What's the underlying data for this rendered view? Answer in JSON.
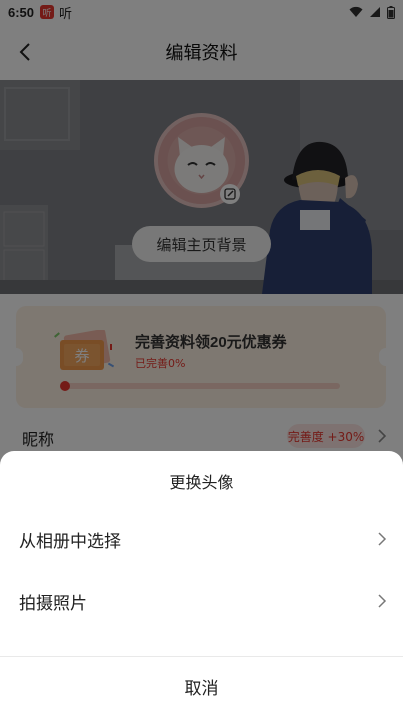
{
  "status_bar": {
    "time": "6:50",
    "app_badge": "听",
    "listen_label": "听",
    "icons": [
      "wifi-icon",
      "signal-icon",
      "battery-icon"
    ]
  },
  "navbar": {
    "title": "编辑资料",
    "back_icon": "chevron-left-icon"
  },
  "hero": {
    "edit_background_label": "编辑主页背景",
    "avatar_edit_icon": "edit-icon"
  },
  "promo": {
    "title": "完善资料领20元优惠券",
    "progress_text": "已完善0%",
    "ticket_text": "券",
    "progress": 0
  },
  "profile_rows": [
    {
      "label": "昵称",
      "badge": "完善度 +30%"
    }
  ],
  "sheet": {
    "title": "更换头像",
    "options": [
      {
        "label": "从相册中选择"
      },
      {
        "label": "拍摄照片"
      }
    ],
    "cancel_label": "取消"
  },
  "colors": {
    "accent": "#e8372f",
    "overlay": "rgba(0,0,0,0.5)",
    "promo_bg": "#fdf0e3",
    "avatar_bg": "#d6a3a0"
  }
}
